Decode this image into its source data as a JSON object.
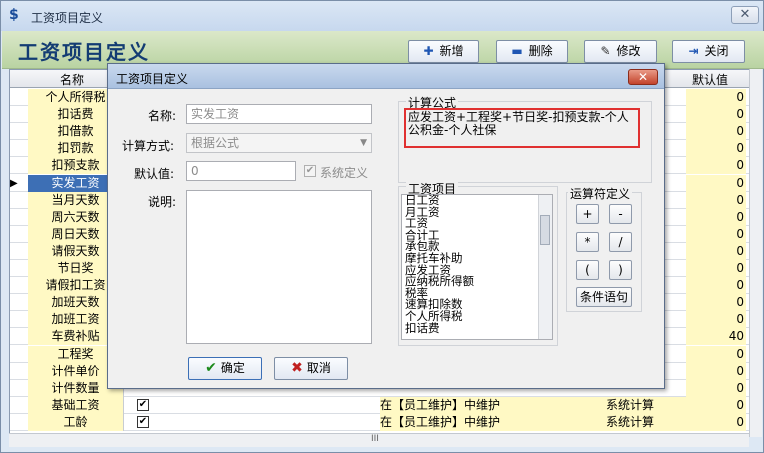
{
  "window": {
    "title": "工资项目定义",
    "close_glyph": "✕"
  },
  "header": {
    "title": "工资项目定义"
  },
  "toolbar": {
    "add_label": "新增",
    "delete_label": "删除",
    "edit_label": "修改",
    "close_label": "关闭"
  },
  "grid": {
    "columns": {
      "name": "名称",
      "default": "默认值"
    },
    "rows": [
      {
        "name": "个人所得税",
        "checked": false,
        "source": "",
        "type": "",
        "default": "0"
      },
      {
        "name": "扣话费",
        "checked": false,
        "source": "",
        "type": "",
        "default": "0"
      },
      {
        "name": "扣借款",
        "checked": false,
        "source": "",
        "type": "",
        "default": "0"
      },
      {
        "name": "扣罚款",
        "checked": false,
        "source": "",
        "type": "",
        "default": "0"
      },
      {
        "name": "扣预支款",
        "checked": false,
        "source": "",
        "type": "",
        "default": "0"
      },
      {
        "name": "实发工资",
        "checked": false,
        "source": "",
        "type": "",
        "default": "0",
        "selected": true
      },
      {
        "name": "当月天数",
        "checked": false,
        "source": "",
        "type": "",
        "default": "0"
      },
      {
        "name": "周六天数",
        "checked": false,
        "source": "",
        "type": "",
        "default": "0"
      },
      {
        "name": "周日天数",
        "checked": false,
        "source": "",
        "type": "",
        "default": "0"
      },
      {
        "name": "请假天数",
        "checked": false,
        "source": "",
        "type": "",
        "default": "0"
      },
      {
        "name": "节日奖",
        "checked": false,
        "source": "",
        "type": "",
        "default": "0"
      },
      {
        "name": "请假扣工资",
        "checked": false,
        "source": "",
        "type": "",
        "default": "0"
      },
      {
        "name": "加班天数",
        "checked": false,
        "source": "",
        "type": "",
        "default": "0"
      },
      {
        "name": "加班工资",
        "checked": false,
        "source": "",
        "type": "",
        "default": "0"
      },
      {
        "name": "车费补贴",
        "checked": false,
        "source": "",
        "type": "",
        "default": "40"
      },
      {
        "name": "工程奖",
        "checked": false,
        "source": "",
        "type": "",
        "default": "0"
      },
      {
        "name": "计件单价",
        "checked": false,
        "source": "",
        "type": "",
        "default": "0"
      },
      {
        "name": "计件数量",
        "checked": false,
        "source": "",
        "type": "",
        "default": "0"
      },
      {
        "name": "基础工资",
        "checked": true,
        "source": "在【员工维护】中维护",
        "type": "系统计算",
        "default": "0"
      },
      {
        "name": "工龄",
        "checked": true,
        "source": "在【员工维护】中维护",
        "type": "系统计算",
        "default": "0"
      }
    ],
    "selected_marker": "▶",
    "check_glyph": "✔"
  },
  "dialog": {
    "title": "工资项目定义",
    "close_glyph": "✕",
    "name_label": "名称:",
    "name_value": "实发工资",
    "method_label": "计算方式:",
    "method_value": "根据公式",
    "default_label": "默认值:",
    "default_value": "0",
    "system_defined_label": "系统定义",
    "desc_label": "说明:",
    "formula_legend": "计算公式",
    "formula": "应发工资+工程奖+节日奖-扣预支款-个人公积金-个人社保",
    "items_legend": "工资项目",
    "items": [
      "日工资",
      "月工资",
      "工资",
      "合计工",
      "承包款",
      "摩托车补助",
      "应发工资",
      "应纳税所得额",
      "税率",
      "速算扣除数",
      "个人所得税",
      "扣话费"
    ],
    "ops_legend": "运算符定义",
    "ops": [
      "+",
      "-",
      "*",
      "/",
      "(",
      ")"
    ],
    "condition_label": "条件语句",
    "ok_label": "确定",
    "cancel_label": "取消"
  },
  "hscroll_label": "III"
}
